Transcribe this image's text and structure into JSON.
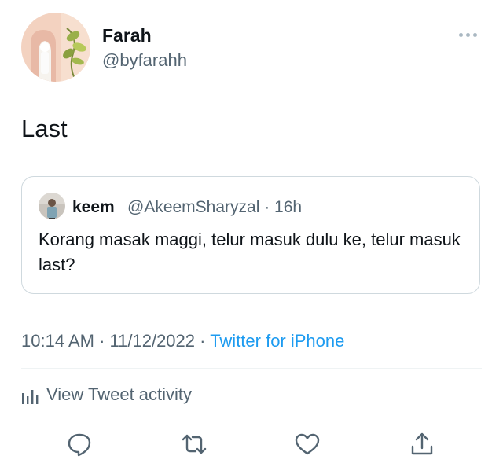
{
  "author": {
    "name": "Farah",
    "handle": "@byfarahh"
  },
  "tweet": {
    "text": "Last",
    "time": "10:14 AM",
    "separator1": "·",
    "date": "11/12/2022",
    "separator2": "·",
    "source": "Twitter for iPhone"
  },
  "quoted": {
    "name": "keem",
    "meta": "@AkeemSharyzal · 16h",
    "text": "Korang masak maggi, telur masuk dulu ke, telur masuk last?"
  },
  "activity": {
    "label": "View Tweet activity",
    "icon": "bar-chart-icon"
  },
  "actions": [
    {
      "icon": "reply-icon"
    },
    {
      "icon": "retweet-icon"
    },
    {
      "icon": "like-icon"
    },
    {
      "icon": "share-icon"
    }
  ],
  "colors": {
    "accent": "#1d9bf0",
    "secondary_text": "#536471",
    "border": "#cfd9de"
  }
}
